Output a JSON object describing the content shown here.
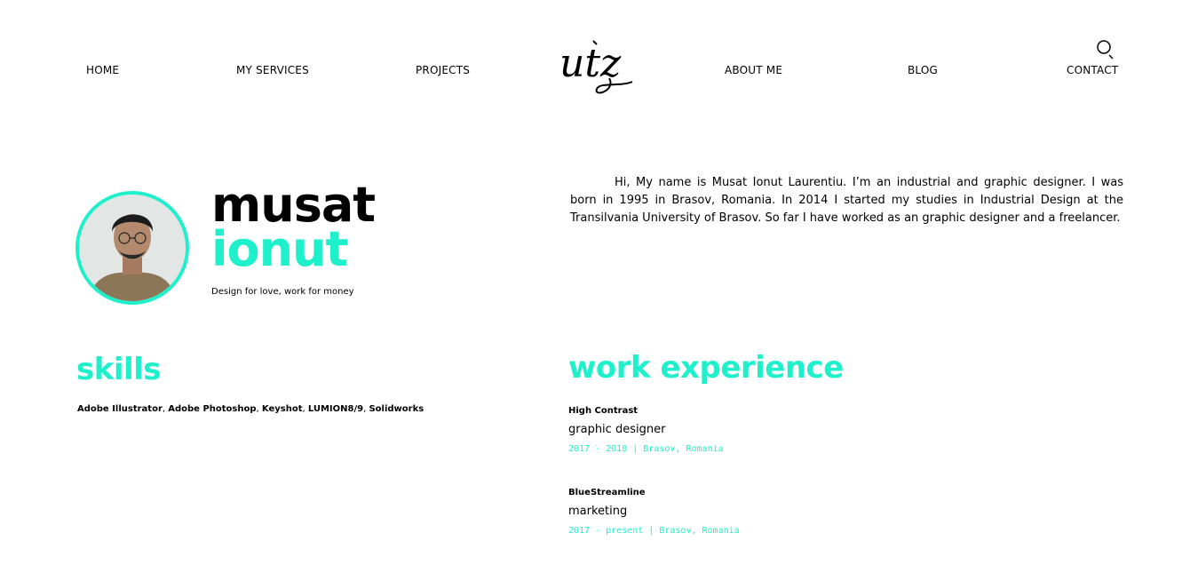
{
  "nav": {
    "home": "HOME",
    "services": "MY SERVICES",
    "projects": "PROJECTS",
    "about": "ABOUT ME",
    "blog": "BLOG",
    "contact": "CONTACT"
  },
  "logo": {
    "text": "utz"
  },
  "profile": {
    "first_name": "musat",
    "last_name": "ionut",
    "tagline": "Design for love, work for money",
    "bio": "Hi, My name is Musat Ionut Laurentiu. I’m an industrial and graphic designer. I was born in 1995 in Brasov, Romania. In 2014 I started my studies in Industrial Design at the Transilvania University of Brasov. So far I have worked as an graphic designer and a freelancer."
  },
  "skills": {
    "title": "skills",
    "items": [
      "Adobe Illustrator",
      "Adobe Photoshop",
      "Keyshot",
      "LUMION8/9",
      "Solidworks"
    ]
  },
  "work": {
    "title": "work experience",
    "jobs": [
      {
        "company": "High Contrast",
        "role": "graphic designer",
        "meta": "2017 - 2018 | Brasov, Romania"
      },
      {
        "company": "BlueStreamline",
        "role": "marketing",
        "meta": "2017 - present | Brasov, Romania"
      }
    ]
  },
  "colors": {
    "accent": "#1ff0cc",
    "text": "#000000",
    "background": "#ffffff"
  }
}
